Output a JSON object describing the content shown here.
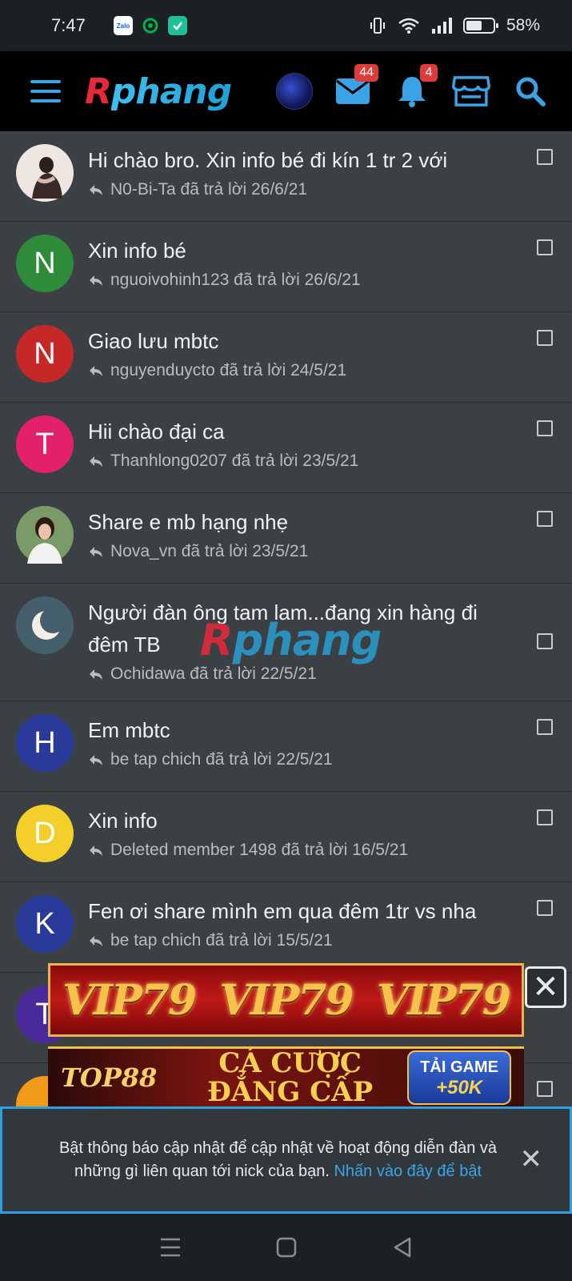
{
  "status_bar": {
    "time": "7:47",
    "battery_percent": "58%",
    "battery_level": 0.58,
    "apps": [
      {
        "name": "zalo-icon",
        "label": "Zalo",
        "bg": "#ffffff",
        "fg": "#0068ff"
      },
      {
        "name": "grab-icon",
        "label": "",
        "bg": "#1d2023",
        "fg": "#00b14f"
      },
      {
        "name": "checkmark-app-icon",
        "label": "",
        "bg": "#1fbf9a",
        "fg": "#ffffff"
      }
    ]
  },
  "header": {
    "logo_part1": "R",
    "logo_part2": "phang",
    "messages_badge": "44",
    "alerts_badge": "4",
    "accent": "#3aa3e6"
  },
  "conversations": [
    {
      "title": "Hi chào bro. Xin info bé đi kín 1 tr 2 với",
      "meta": "N0-Bi-Ta đã trả lời 26/6/21",
      "avatar_letter": "",
      "avatar_color": "#e8e0d8",
      "avatar_type": "photo-light"
    },
    {
      "title": "Xin info bé",
      "meta": "nguoivohinh123 đã trả lời 26/6/21",
      "avatar_letter": "N",
      "avatar_color": "#2e8b3a",
      "avatar_type": "letter"
    },
    {
      "title": "Giao lưu mbtc",
      "meta": "nguyenduycto đã trả lời 24/5/21",
      "avatar_letter": "N",
      "avatar_color": "#c62828",
      "avatar_type": "letter"
    },
    {
      "title": "Hii chào đại ca",
      "meta": "Thanhlong0207 đã trả lời 23/5/21",
      "avatar_letter": "T",
      "avatar_color": "#e3206b",
      "avatar_type": "letter"
    },
    {
      "title": "Share e mb hạng nhẹ",
      "meta": "Nova_vn đã trả lời 23/5/21",
      "avatar_letter": "",
      "avatar_color": "#6a8a5a",
      "avatar_type": "photo-green"
    },
    {
      "title": "Người đàn ông tam lam...đang xin hàng đi đêm TB",
      "meta": "Ochidawa đã trả lời 22/5/21",
      "avatar_letter": "",
      "avatar_color": "#3d5a6a",
      "avatar_type": "photo-moon"
    },
    {
      "title": "Em mbtc",
      "meta": "be tap chich đã trả lời 22/5/21",
      "avatar_letter": "H",
      "avatar_color": "#2a3a9a",
      "avatar_type": "letter"
    },
    {
      "title": "Xin info",
      "meta": "Deleted member 1498 đã trả lời 16/5/21",
      "avatar_letter": "D",
      "avatar_color": "#f2cf2a",
      "avatar_type": "letter"
    },
    {
      "title": "Fen ơi share mình em qua đêm 1tr vs nha",
      "meta": "be tap chich đã trả lời 15/5/21",
      "avatar_letter": "K",
      "avatar_color": "#2a3a9a",
      "avatar_type": "letter"
    },
    {
      "title": "",
      "meta": "",
      "avatar_letter": "T",
      "avatar_color": "#4a2a9a",
      "avatar_type": "letter"
    },
    {
      "title": "",
      "meta": "",
      "avatar_letter": "",
      "avatar_color": "#f29a1a",
      "avatar_type": "letter"
    }
  ],
  "watermark": {
    "part1": "R",
    "part2": "phang"
  },
  "ads": {
    "banner1_words": [
      "VIP79",
      "VIP79",
      "VIP79"
    ],
    "banner2_brand": "TOP88",
    "banner2_headline": "CÁ CƯỢC ĐẲNG CẤP",
    "banner2_cta": "TẢI GAME",
    "banner2_bonus": "+50K"
  },
  "notification": {
    "message": "Bật thông báo cập nhật để cập nhật về hoạt động diễn đàn và những gì liên quan tới nick của bạn.",
    "link_text": "Nhấn vào đây để bật",
    "close_glyph": "✕"
  }
}
